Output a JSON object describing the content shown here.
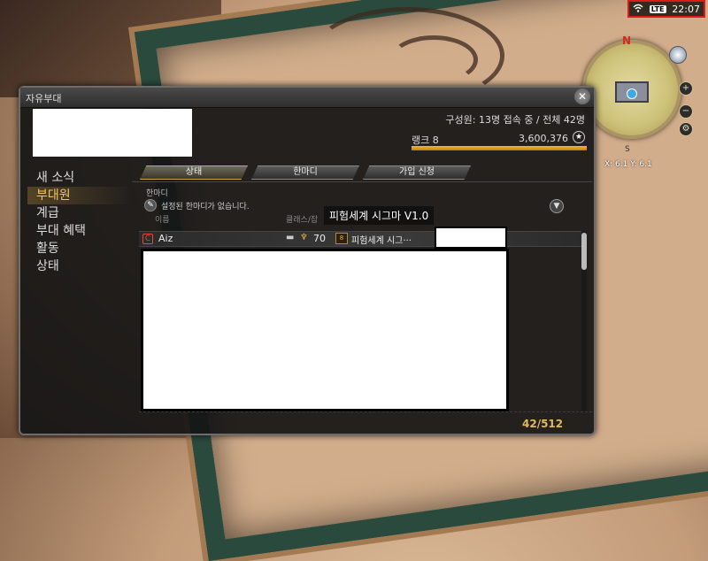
{
  "status_bar": {
    "network": "LTE",
    "time": "22:07"
  },
  "minimap": {
    "north": "N",
    "south": "S",
    "coords": "X: 6.1 Y: 6.1"
  },
  "window": {
    "title": "자유부대",
    "members_summary": "구성원: 13명 접속 중 / 전체 42명",
    "rank_label": "랭크 8",
    "rank_value": "3,600,376",
    "rank_progress": 1.0
  },
  "nav": {
    "items": [
      {
        "label": "새 소식",
        "active": false
      },
      {
        "label": "부대원",
        "active": true
      },
      {
        "label": "계급",
        "active": false
      },
      {
        "label": "부대 혜택",
        "active": false
      },
      {
        "label": "활동",
        "active": false
      },
      {
        "label": "상태",
        "active": false
      }
    ]
  },
  "tabs": [
    {
      "label": "상태",
      "active": true
    },
    {
      "label": "한마디",
      "active": false
    },
    {
      "label": "가입 신청",
      "active": false
    }
  ],
  "motto": {
    "label": "한마디",
    "text": "설정된 한마디가 없습니다."
  },
  "columns": {
    "name": "이름",
    "class": "클래스/잡"
  },
  "tooltip": "피험세계 시그마 V1.0",
  "members": [
    {
      "name": "Aiz",
      "level": "70",
      "rank_name": "피험세계 시그···"
    }
  ],
  "counter": "42/512"
}
